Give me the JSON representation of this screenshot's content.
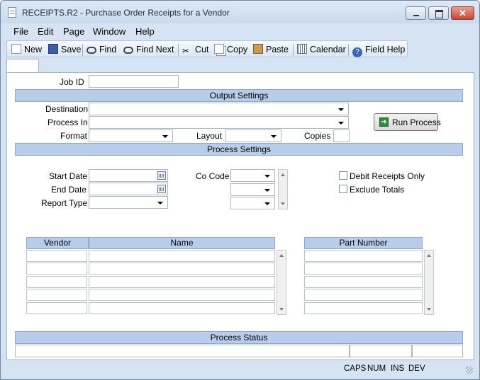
{
  "window": {
    "title": "RECEIPTS.R2 - Purchase Order Receipts for a Vendor"
  },
  "menu": [
    "File",
    "Edit",
    "Page",
    "Window",
    "Help"
  ],
  "toolbar": {
    "new": "New",
    "save": "Save",
    "find": "Find",
    "find_next": "Find Next",
    "cut": "Cut",
    "copy": "Copy",
    "paste": "Paste",
    "calendar": "Calendar",
    "field_help": "Field Help"
  },
  "form": {
    "job_id_label": "Job ID",
    "output_settings": "Output Settings",
    "destination_label": "Destination",
    "process_in_label": "Process In",
    "format_label": "Format",
    "layout_label": "Layout",
    "copies_label": "Copies",
    "run_process": "Run Process",
    "process_settings": "Process Settings",
    "start_date_label": "Start Date",
    "end_date_label": "End Date",
    "report_type_label": "Report Type",
    "co_code_label": "Co Code",
    "debit_receipts_only": "Debit Receipts Only",
    "exclude_totals": "Exclude Totals",
    "vendor_header": "Vendor",
    "name_header": "Name",
    "part_number_header": "Part Number",
    "process_status": "Process Status"
  },
  "statusbar": {
    "caps": "CAPS",
    "num": "NUM",
    "ins": "INS",
    "dev": "DEV"
  },
  "colors": {
    "section_bar": "#b8cde9",
    "window_frame": "#d6e3f2"
  }
}
